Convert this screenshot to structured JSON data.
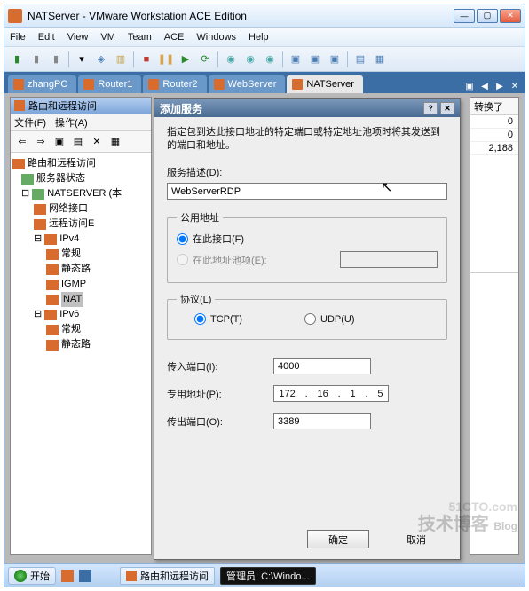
{
  "window": {
    "title": "NATServer - VMware Workstation ACE Edition",
    "min": "—",
    "max": "▢",
    "close": "✕"
  },
  "menu": [
    "File",
    "Edit",
    "View",
    "VM",
    "Team",
    "ACE",
    "Windows",
    "Help"
  ],
  "tabs": {
    "items": [
      "zhangPC",
      "Router1",
      "Router2",
      "WebServer",
      "NATServer"
    ],
    "active": 4
  },
  "inner": {
    "title": "路由和远程访问",
    "menu": {
      "file": "文件(F)",
      "action": "操作(A)"
    }
  },
  "tree": {
    "root": "路由和远程访问",
    "serverStatus": "服务器状态",
    "natserver": "NATSERVER (本",
    "netif": "网络接口",
    "remote": "远程访问E",
    "ipv4": "IPv4",
    "ipv4_items": [
      "常规",
      "静态路",
      "IGMP",
      "NAT"
    ],
    "ipv6": "IPv6",
    "ipv6_items": [
      "常规",
      "静态路"
    ]
  },
  "rightpane": {
    "header": "转换了",
    "rows": [
      "0",
      "0",
      "2,188"
    ]
  },
  "dialog": {
    "title": "添加服务",
    "help": "?",
    "close": "✕",
    "note": "指定包到达此接口地址的特定端口或特定地址池项时将其发送到的端口和地址。",
    "desc_label": "服务描述(D):",
    "desc_value": "WebServerRDP",
    "public_group": "公用地址",
    "radio_onif": "在此接口(F)",
    "radio_pool": "在此地址池项(E):",
    "proto_group": "协议(L)",
    "tcp": "TCP(T)",
    "udp": "UDP(U)",
    "inport_label": "传入端口(I):",
    "inport_value": "4000",
    "priv_label": "专用地址(P):",
    "priv_ip": [
      "172",
      ".",
      "16",
      ".",
      "1",
      ".",
      "5"
    ],
    "outport_label": "传出端口(O):",
    "outport_value": "3389",
    "ok": "确定",
    "cancel": "取消"
  },
  "status": {
    "start": "开始",
    "task1": "路由和远程访问",
    "task2": "管理员: C:\\Windo..."
  },
  "watermark": {
    "line1": "51CTO.com",
    "line2": "技术博客",
    "line3": "Blog"
  }
}
